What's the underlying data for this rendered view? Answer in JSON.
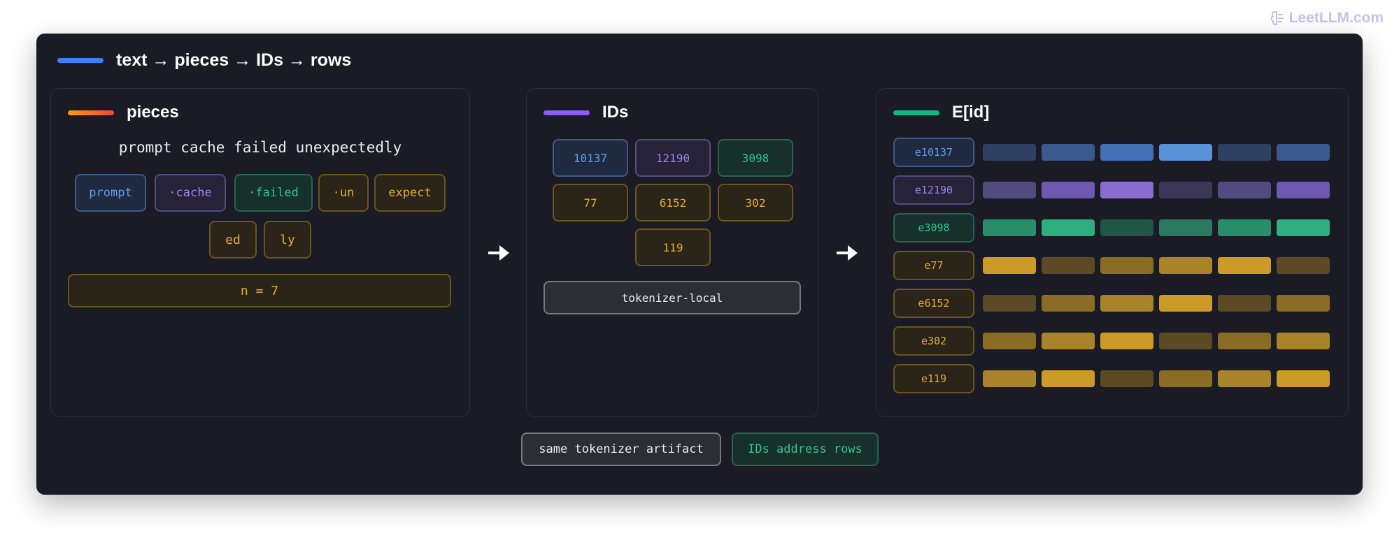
{
  "watermark": "LeetLLM.com",
  "title": "text → pieces → IDs → rows",
  "pieces": {
    "title": "pieces",
    "text": "prompt cache failed unexpectedly",
    "tokens": [
      "prompt",
      "·cache",
      "·failed",
      "·un",
      "expect",
      "ed",
      "ly"
    ],
    "count": "n = 7"
  },
  "ids": {
    "title": "IDs",
    "values": [
      "10137",
      "12190",
      "3098",
      "77",
      "6152",
      "302",
      "119"
    ],
    "tokenizer": "tokenizer-local"
  },
  "embed": {
    "title": "E[id]",
    "rows": [
      {
        "label": "e10137",
        "colors": [
          "#2e4163",
          "#3a5a8f",
          "#4471b5",
          "#5a92d8",
          "#2e4163",
          "#3a5a8f"
        ]
      },
      {
        "label": "e12190",
        "colors": [
          "#544a82",
          "#6e58b0",
          "#8a6cd0",
          "#3d3656",
          "#544a82",
          "#6e58b0"
        ]
      },
      {
        "label": "e3098",
        "colors": [
          "#2a8d69",
          "#2fae80",
          "#1f5646",
          "#2a7a5f",
          "#2a8d69",
          "#2fae80"
        ]
      },
      {
        "label": "e77",
        "colors": [
          "#cc9a26",
          "#5c4a24",
          "#8a6c24",
          "#a8832a",
          "#cc9a26",
          "#5c4a24"
        ]
      },
      {
        "label": "e6152",
        "colors": [
          "#5c4a24",
          "#8a6c24",
          "#a8832a",
          "#cc9a26",
          "#5c4a24",
          "#8a6c24"
        ]
      },
      {
        "label": "e302",
        "colors": [
          "#8a6c24",
          "#a8832a",
          "#cc9a26",
          "#5c4a24",
          "#8a6c24",
          "#a8832a"
        ]
      },
      {
        "label": "e119",
        "colors": [
          "#a8832a",
          "#cc9a26",
          "#5c4a24",
          "#8a6c24",
          "#a8832a",
          "#cc9a26"
        ]
      }
    ]
  },
  "footer": {
    "left": "same tokenizer artifact",
    "right": "IDs address rows"
  },
  "colors": {
    "title_bar": "#3b82f6",
    "pieces_bar": "#f97316",
    "ids_bar": "#8b5cf6",
    "embed_bar": "#10b981"
  }
}
